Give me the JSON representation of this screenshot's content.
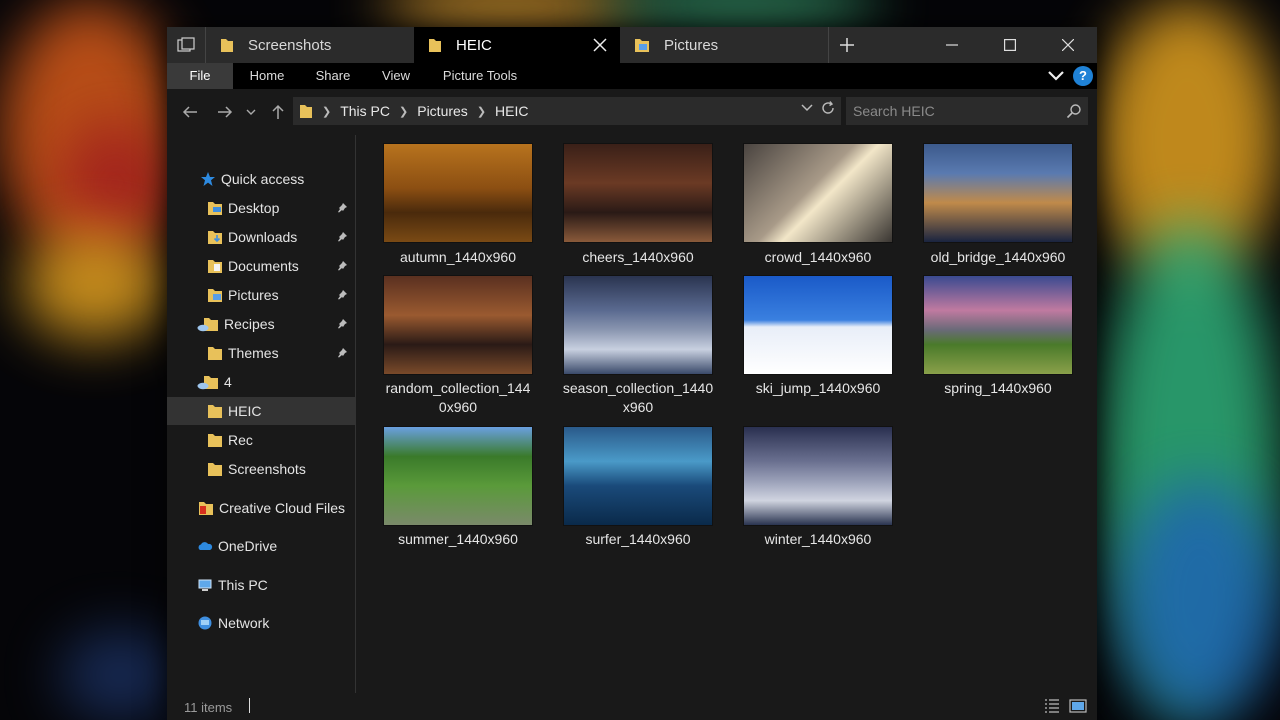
{
  "tabs": [
    {
      "label": "Screenshots"
    },
    {
      "label": "HEIC"
    },
    {
      "label": "Pictures"
    }
  ],
  "window_controls": {
    "new_tab": "+"
  },
  "ribbon": {
    "tabs": [
      "File",
      "Home",
      "Share",
      "View",
      "Picture Tools"
    ],
    "help": "?"
  },
  "address": {
    "crumbs": [
      "This PC",
      "Pictures",
      "HEIC"
    ]
  },
  "search": {
    "placeholder": "Search HEIC"
  },
  "nav": {
    "items": [
      {
        "label": "Quick access",
        "icon": "star-icon"
      },
      {
        "label": "Desktop",
        "icon": "desktop-folder-icon",
        "pinned": true
      },
      {
        "label": "Downloads",
        "icon": "downloads-folder-icon",
        "pinned": true
      },
      {
        "label": "Documents",
        "icon": "documents-folder-icon",
        "pinned": true
      },
      {
        "label": "Pictures",
        "icon": "pictures-folder-icon",
        "pinned": true
      },
      {
        "label": "Recipes",
        "icon": "cloud-folder-icon",
        "pinned": true
      },
      {
        "label": "Themes",
        "icon": "folder-icon",
        "pinned": true
      },
      {
        "label": "4",
        "icon": "cloud-folder-icon"
      },
      {
        "label": "HEIC",
        "icon": "folder-icon",
        "selected": true
      },
      {
        "label": "Rec",
        "icon": "folder-icon"
      },
      {
        "label": "Screenshots",
        "icon": "folder-icon"
      },
      {
        "label": "Creative Cloud Files",
        "icon": "creative-cloud-folder-icon"
      },
      {
        "label": "OneDrive",
        "icon": "onedrive-cloud-icon"
      },
      {
        "label": "This PC",
        "icon": "this-pc-icon"
      },
      {
        "label": "Network",
        "icon": "network-icon"
      }
    ]
  },
  "files": [
    {
      "name": "autumn_1440x960"
    },
    {
      "name": "cheers_1440x960"
    },
    {
      "name": "crowd_1440x960"
    },
    {
      "name": "old_bridge_1440x960"
    },
    {
      "name": "random_collection_1440x960",
      "line1": "random_collection_144",
      "line2": "0x960"
    },
    {
      "name": "season_collection_1440x960",
      "line1": "season_collection_1440",
      "line2": "x960"
    },
    {
      "name": "ski_jump_1440x960"
    },
    {
      "name": "spring_1440x960"
    },
    {
      "name": "summer_1440x960"
    },
    {
      "name": "surfer_1440x960"
    },
    {
      "name": "winter_1440x960"
    }
  ],
  "status": {
    "item_count": "11 items"
  },
  "colors": {
    "accent": "#1f82d6",
    "folder": "#e8c15a",
    "window_bg": "#191919"
  }
}
